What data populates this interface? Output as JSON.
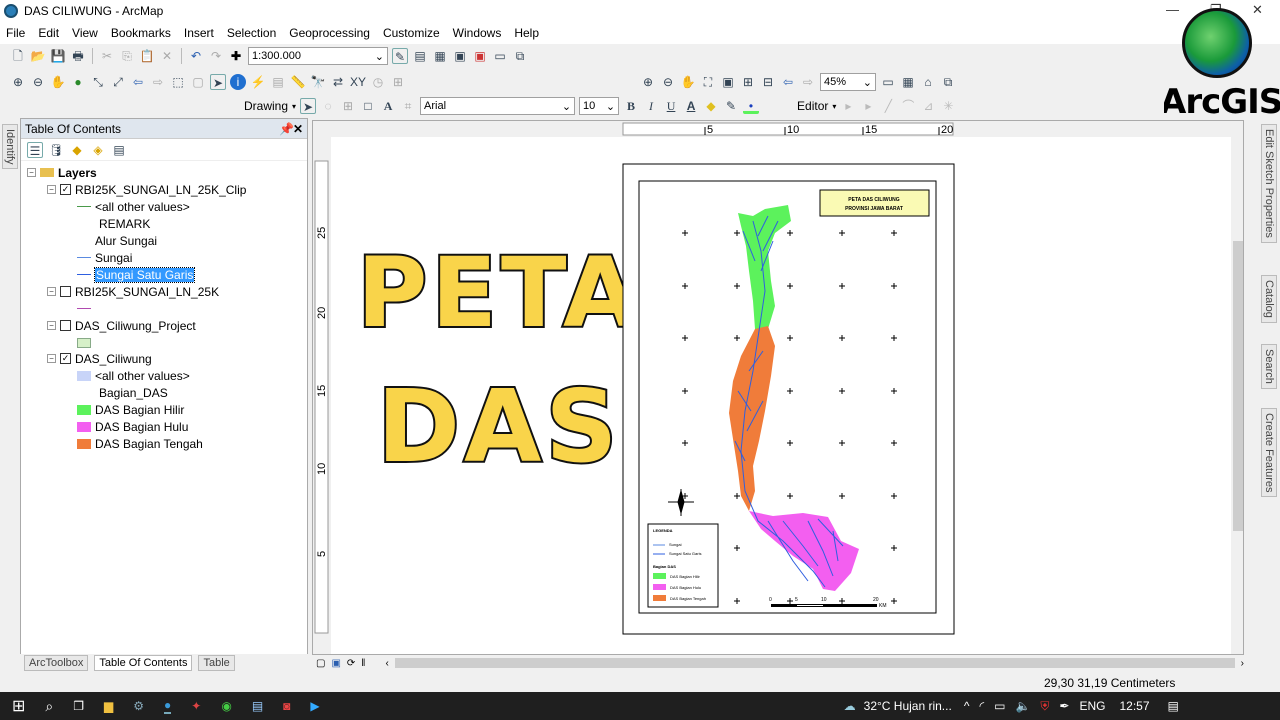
{
  "window": {
    "title": "DAS CILIWUNG - ArcMap"
  },
  "menu": [
    "File",
    "Edit",
    "View",
    "Bookmarks",
    "Insert",
    "Selection",
    "Geoprocessing",
    "Customize",
    "Windows",
    "Help"
  ],
  "toolbar": {
    "scale": "1:300.000",
    "zoom": "45%",
    "drawing_label": "Drawing",
    "font_name": "Arial",
    "font_size": "10",
    "editor_label": "Editor",
    "bold": "B",
    "italic": "I",
    "underline": "U",
    "text_color": "A"
  },
  "logo": {
    "text": "ArcGIS"
  },
  "toc": {
    "title": "Table Of Contents",
    "root": "Layers",
    "layers": [
      {
        "name": "RBI25K_SUNGAI_LN_25K_Clip",
        "checked": true,
        "items": [
          "<all other values>",
          "REMARK",
          "Alur Sungai",
          "Sungai",
          "Sungai Satu Garis"
        ]
      },
      {
        "name": "RBI25K_SUNGAI_LN_25K",
        "checked": false
      },
      {
        "name": "DAS_Ciliwung_Project",
        "checked": false
      },
      {
        "name": "DAS_Ciliwung",
        "checked": true,
        "items": [
          "<all other values>",
          "Bagian_DAS",
          "DAS Bagian Hilir",
          "DAS Bagian Hulu",
          "DAS Bagian Tengah"
        ]
      }
    ],
    "tabs": [
      "ArcToolbox",
      "Table Of Contents",
      "Table"
    ]
  },
  "left_strip": {
    "identify": "Identify"
  },
  "right_strip": [
    "Edit Sketch Properties",
    "Catalog",
    "Search",
    "Create Features"
  ],
  "ruler": {
    "top": [
      "5",
      "10",
      "15",
      "20"
    ],
    "left": [
      "25",
      "20",
      "15",
      "10",
      "5"
    ]
  },
  "layout": {
    "heading_line1": "PETA",
    "heading_line2": "DAS",
    "map_title_1": "PETA DAS CILIWUNG",
    "map_title_2": "PROVINSI JAWA BARAT",
    "legend": {
      "title": "LEGENDA",
      "sungai": "Sungai",
      "sungai_satu": "Sungai Satu Garis",
      "group": "Bagian DAS",
      "hilir": "DAS Bagian Hilir",
      "hulu": "DAS Bagian Hulu",
      "tengah": "DAS Bagian Tengah"
    },
    "scalebar": [
      "0",
      "5",
      "10",
      "20"
    ],
    "scale_unit": "KM",
    "colors": {
      "hilir": "#5cf25c",
      "hulu": "#f35ff0",
      "tengah": "#f07c3a",
      "river": "#2e5fe0"
    }
  },
  "status": {
    "coords": "29,30  31,19 Centimeters"
  },
  "taskbar": {
    "weather": "32°C  Hujan rin...",
    "lang": "ENG",
    "time": "12:57"
  }
}
